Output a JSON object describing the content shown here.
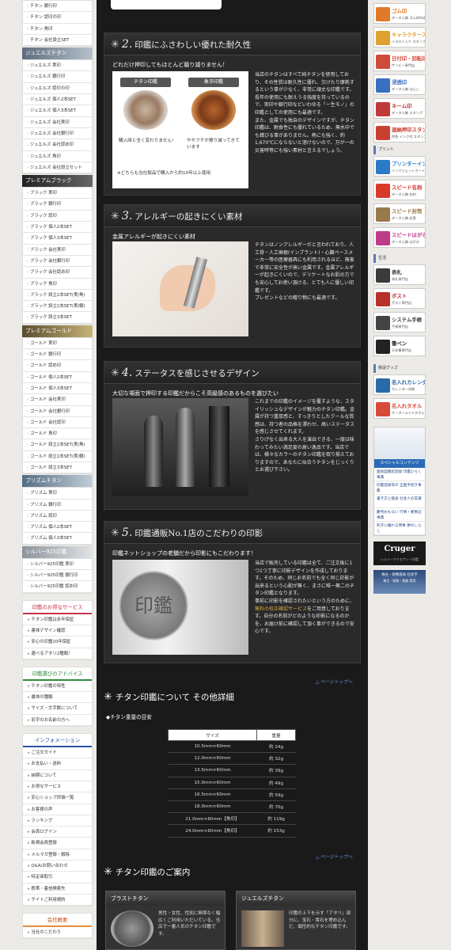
{
  "left_nav": {
    "top_items": [
      "チタン 銀行印",
      "チタン 認印の印",
      "チタン 角印",
      "チタン 会社設立SET"
    ],
    "groups": [
      {
        "title": "ジュエルズチタン",
        "items": [
          "ジュエルズ 実印",
          "ジュエルズ 銀行印",
          "ジュエルズ 認印の印",
          "ジュエルズ 個人2本SET",
          "ジュエルズ 個人3本SET",
          "ジュエルズ 会社実印",
          "ジュエルズ 会社銀行印",
          "ジュエルズ 会社認め印",
          "ジュエルズ 角印",
          "ジュエルズ 会社設立セット"
        ]
      },
      {
        "title": "プレミアムブラック",
        "items": [
          "ブラック 実印",
          "ブラック 銀行印",
          "ブラック 認印",
          "ブラック 個人2本SET",
          "ブラック 個人3本SET",
          "ブラック 会社実印",
          "ブラック 会社銀行印",
          "ブラック 会社認め印",
          "ブラック 角印",
          "ブラック 設立2本SET(実/角)",
          "ブラック 設立2本SET(実/銀)",
          "ブラック 設立3本SET"
        ]
      },
      {
        "title": "プレミアムゴールド",
        "items": [
          "ゴールド 実印",
          "ゴールド 銀行印",
          "ゴールド 認め印",
          "ゴールド 個人2本SET",
          "ゴールド 個人3本SET",
          "ゴールド 会社実印",
          "ゴールド 会社銀行印",
          "ゴールド 会社認印",
          "ゴールド 角印",
          "ゴールド 設立2本SET(実/角)",
          "ゴールド 設立2本SET(実/銀)",
          "ゴールド 設立3本SET"
        ]
      },
      {
        "title": "プリズムチタン",
        "items": [
          "プリズム 実印",
          "プリズム 銀行印",
          "プリズム 認印",
          "プリズム 個人2本SET",
          "プリズム 個人3本SET"
        ]
      },
      {
        "title": "シルバー925印鑑",
        "items": [
          "シルバー925印鑑 実印",
          "シルバー925印鑑 銀行印",
          "シルバー925印鑑 認め印"
        ]
      }
    ],
    "boxes": [
      {
        "title": "印鑑のお得なサービス",
        "color": "red",
        "items": [
          "チタン印鑑は永年保証",
          "書体デザイン確認",
          "安心の印鑑10年保証",
          "選べるアタリ2種類！"
        ]
      },
      {
        "title": "印鑑選びのアドバイス",
        "color": "grn",
        "items": [
          "チタン印鑑の特性",
          "書体の種類",
          "サイズ・文字数について",
          "旧字のお名前の方へ"
        ]
      },
      {
        "title": "インフォメーション",
        "color": "blu",
        "items": [
          "ご注文ガイド",
          "お支払い・送料",
          "納期について",
          "お得なサービス",
          "安心ショップ評価一覧",
          "お客様の声",
          "ランキング",
          "会員ログイン",
          "新規会員登録",
          "メルマガ登録・解除",
          "Q&A/お問い合わせ",
          "特定商取引",
          "携帯・着信検索先",
          "サイトご利用規約"
        ]
      },
      {
        "title": "会社概要",
        "color": "org",
        "items": [
          "当社のこだわり"
        ]
      }
    ]
  },
  "sections": [
    {
      "num": "2.",
      "title": "印鑑にふさわしい優れた耐久性",
      "sub": "どれだけ押印してもほとんど磨り減りません！",
      "photo_labels": [
        "チタン印鑑",
        "象牙印鑑"
      ],
      "photo_captions": [
        "購入時と全く変わりません!",
        "ややフチが擦り減ってきています"
      ],
      "photo_note": "※どちらも当社製品で購入から約10年以上使用",
      "body": "当店のチタンはすべて純チタンを使用しており、その性質は耐久性に優れ、欠けたり摩耗するという事が少なく、非常に頑丈な印鑑です。長年の使用にも耐えうる強度を持っているので、実印や銀行印などいわゆる「一生モノ」の印鑑としての使用にも最適です。",
      "body2": "また、金属でも独自のデザインですが、チタン印鑑は、耐食性にも優れているため、無水中でも錆びる事がありません。熱にも強く、約1,670℃にならないと溶けないので、万が一の災害時等にも強い素材と言えるでしょう。"
    },
    {
      "num": "3.",
      "title": "アレルギーの起きにくい素材",
      "sub": "金属アレルギーが起きにくい素材",
      "body": "チタンはノンアレルギーだと言われており、人工骨・人工歯根(インプラント)・心臓ペースメーカー等の医療器具にも利用されるほど、無害で非常に安全性が高い金属です。金属アレルギーが起きにくいので、デリケートなお肌の方でも安心してお使い頂ける、とても人に優しい印鑑です。",
      "body2": "プレゼントなどの贈り物にも最適です。"
    },
    {
      "num": "4.",
      "title": "ステータスを感じさせるデザイン",
      "sub": "大切な場面で押印する印鑑だからこそ高級感のあるものを選びたい",
      "body": "これまでの印鑑のイメージを覆すような、スタイリッシュなデザインが魅力のチタン印鑑。金属が持つ重厚感と、すっきりとしたクールな質感は、持つ者の品格を漂わせ、高いステータスを感じさせてくれます。",
      "body2": "さりげなく出来る大人を演出できる、一度は味わってみたい満足度の高い逸品です。当店では、様々なカラーのチタン印鑑を取り揃えておりますので、あなたに似合うチタンをじっくりとお選び下さい。"
    },
    {
      "num": "5.",
      "title": "印鑑通販No.1店のこだわりの印影",
      "sub": "印鑑ネットショップの老舗だから印影にもこだわります！",
      "seal_text": "印鑑",
      "body": "当店で販売している印鑑は全て、ご注文後に1つ1つ丁寧に印影デザインを作成しております。そのため、同じお名前でも全く同じ印影が出来るという心配が無く、まさに唯一無二のチタン印鑑となります。",
      "body2": "事前に印影を確認されたいという方のために、",
      "body2_link": "無料の校正確認サービス",
      "body2_end": "をご用意しております。自分の名前がどのような印影になるのかを、お届け前に確認して頂く事ができるので安心です。"
    }
  ],
  "page_top": "△ ページトップへ",
  "details": {
    "heading": "チタン印鑑について その他詳細",
    "weight_label": "◆チタン重量の目安",
    "columns": [
      "サイズ",
      "重量"
    ],
    "rows": [
      [
        "10.5mm×60mm",
        "約 24g"
      ],
      [
        "12.0mm×60mm",
        "約 32g"
      ],
      [
        "13.5mm×60mm",
        "約 39g"
      ],
      [
        "15.0mm×60mm",
        "約 49g"
      ],
      [
        "16.5mm×60mm",
        "約 59g"
      ],
      [
        "18.0mm×60mm",
        "約 70g"
      ],
      [
        "21.0mm×60mm【角印】",
        "約 119g"
      ],
      [
        "24.0mm×60mm【角印】",
        "約 153g"
      ]
    ]
  },
  "guide": {
    "heading": "チタン印鑑のご案内",
    "cards": [
      {
        "title": "ブラストチタン",
        "body": "男性・女性、性別に関係なく幅広くご利用いただいている。当店で一番人気のチタン印鑑です。"
      },
      {
        "title": "ジュエルズチタン",
        "body": "印鑑の上下を示す「アタリ」部分に、宝石・貴石を埋め込んだ、個性的なチタン印鑑です。"
      }
    ]
  },
  "right_banners": [
    {
      "title": "ゴム印",
      "sub": "データ入稿 ゴム印作成",
      "color": "#e07a2a"
    },
    {
      "title": "キャラクタースタンプ",
      "sub": "イラスト入り スタンプ",
      "color": "#e0a030"
    },
    {
      "title": "日付印・回転印",
      "sub": "サンビー専門店",
      "color": "#d04a3a"
    },
    {
      "title": "浸透印",
      "sub": "データ入稿 はんこ",
      "color": "#3a6fc0"
    },
    {
      "title": "ネーム印",
      "sub": "データ入稿 スタンプ",
      "color": "#c03a3a"
    },
    {
      "title": "速納押印スタンプ",
      "sub": "特急 インク付 スタンプ",
      "color": "#c84030"
    }
  ],
  "right_cat_print": "プリント",
  "right_print_banners": [
    {
      "title": "プリンターインク",
      "sub": "インクジェットカートリッジ",
      "color": "#2a7ac8"
    },
    {
      "title": "スピード名刺",
      "sub": "データ入稿 名刺",
      "color": "#d83a2a"
    },
    {
      "title": "スピード封筒",
      "sub": "データ入稿 封筒",
      "color": "#9a7a4a"
    },
    {
      "title": "スピードはがき",
      "sub": "データ入稿 はがき",
      "color": "#c03a8a"
    }
  ],
  "right_cat_life": "生活",
  "right_life_banners": [
    {
      "title": "表札",
      "sub": "表札専門店",
      "color": "#3a3a3a"
    },
    {
      "title": "ポスト",
      "sub": "ポスト専門店",
      "color": "#b8302a"
    },
    {
      "title": "システム手帳",
      "sub": "手帳専門店",
      "color": "#444"
    },
    {
      "title": "筆ペン",
      "sub": "万年筆専門店",
      "color": "#222"
    }
  ],
  "right_cat_goods": "販促グッズ",
  "right_goods_banners": [
    {
      "title": "名入れカレンダー",
      "sub": "カレンダー印刷",
      "color": "#2a6aa8"
    },
    {
      "title": "名入れタオル",
      "sub": "オーダーメイドタオル",
      "color": "#d84a3a"
    }
  ],
  "special": {
    "title": "スペシャルコンテンツ",
    "items": [
      "国会図書館登録 印鑑ひろく事典",
      "印鑑登録等の 全国手続き事典",
      "書き方と敬語 社会人の常識",
      "慶弔おもない 行事・催事記事典",
      "利子に纏わる時事 夢のしらし"
    ]
  },
  "cruger": {
    "title": "Cruger",
    "sub": "シルバーアクセサリー印鑑"
  },
  "tokiwa": {
    "title": "株主・財務諸表 社長学",
    "sub": "株主・財務・税務 実用"
  }
}
